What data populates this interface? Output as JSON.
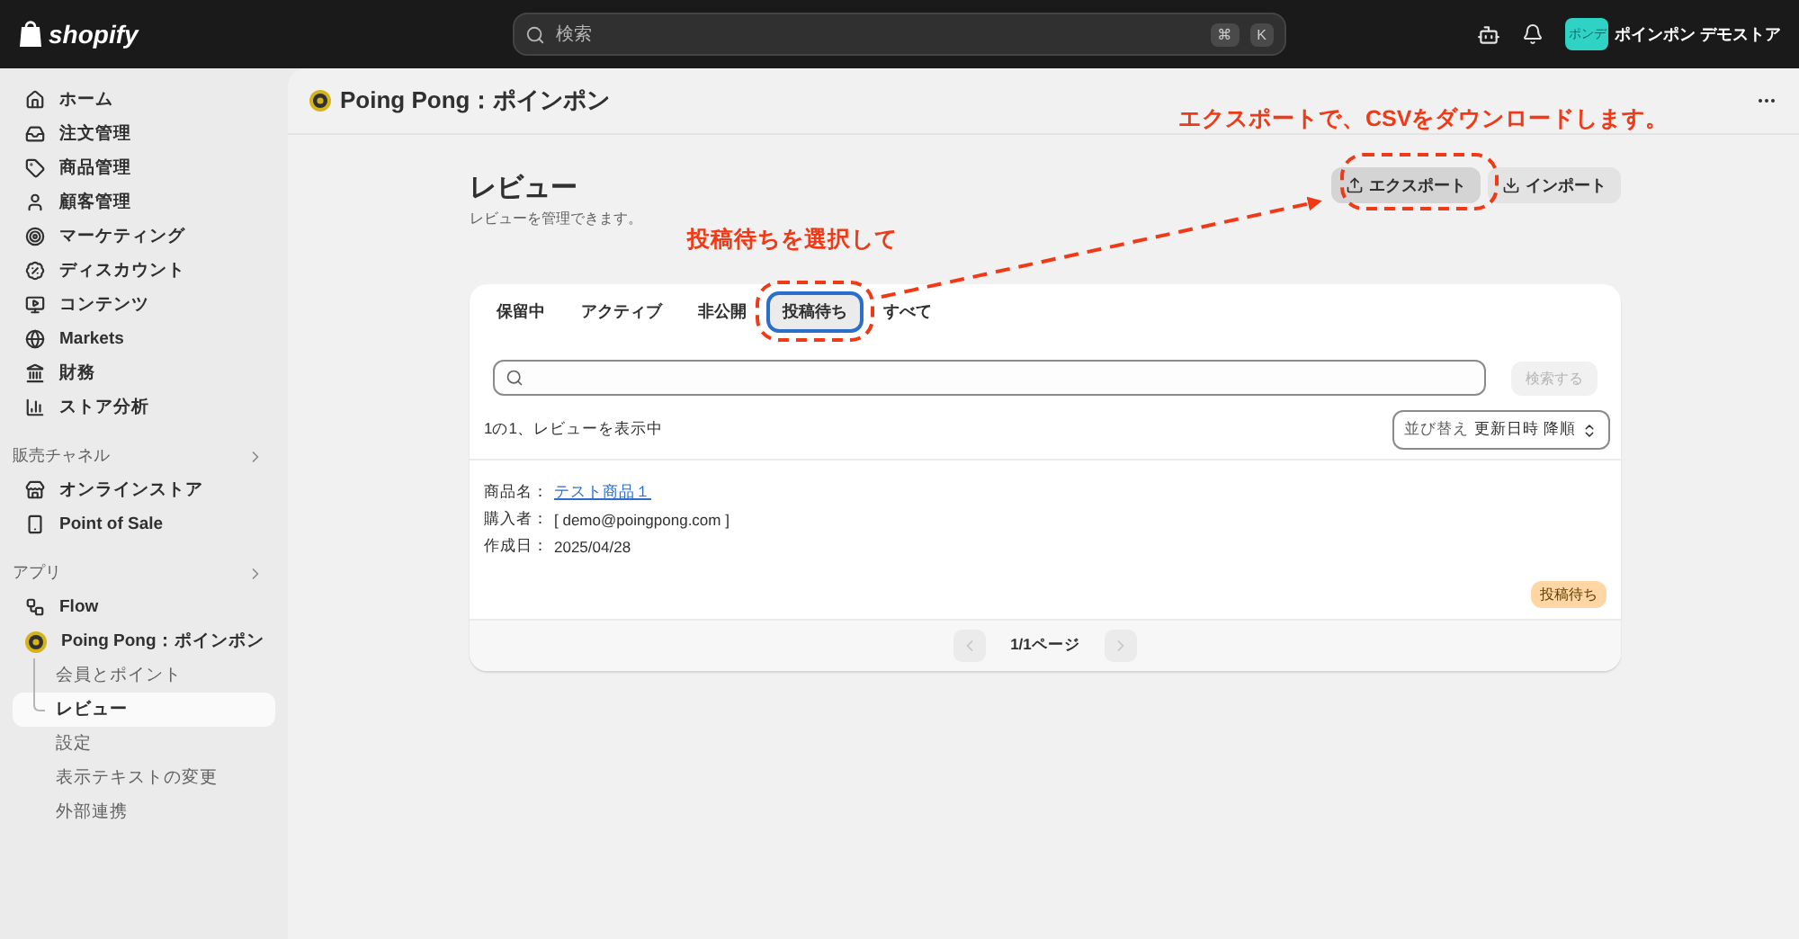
{
  "topbar": {
    "logo": "shopify",
    "search": {
      "placeholder": "検索",
      "keys": [
        "⌘",
        "K"
      ]
    },
    "store": {
      "avatar_text": "ポンデ",
      "name": "ポインポン デモストア"
    }
  },
  "sidebar": {
    "items": [
      {
        "label": "ホーム",
        "selected": false
      },
      {
        "label": "注文管理",
        "selected": false
      },
      {
        "label": "商品管理",
        "selected": false
      },
      {
        "label": "顧客管理",
        "selected": false
      },
      {
        "label": "マーケティング",
        "selected": false
      },
      {
        "label": "ディスカウント",
        "selected": false
      },
      {
        "label": "コンテンツ",
        "selected": false
      },
      {
        "label": "Markets",
        "selected": false
      },
      {
        "label": "財務",
        "selected": false
      },
      {
        "label": "ストア分析",
        "selected": false
      }
    ],
    "sections": [
      {
        "title": "販売チャネル",
        "items": [
          {
            "label": "オンラインストア",
            "selected": false
          },
          {
            "label": "Point of Sale",
            "selected": false
          }
        ]
      },
      {
        "title": "アプリ",
        "items": [
          {
            "label": "Flow",
            "selected": false
          },
          {
            "label": "Poing Pong：ポインポン",
            "selected": false,
            "children": [
              {
                "label": "会員とポイント",
                "selected": false
              },
              {
                "label": "レビュー",
                "selected": true
              },
              {
                "label": "設定",
                "selected": false
              },
              {
                "label": "表示テキストの変更",
                "selected": false
              },
              {
                "label": "外部連携",
                "selected": false
              }
            ]
          }
        ]
      }
    ]
  },
  "app_header": {
    "title": "Poing Pong：ポインポン"
  },
  "page": {
    "title": "レビュー",
    "subtitle": "レビューを管理できます。",
    "actions": [
      {
        "label": "エクスポート",
        "kind": "export",
        "pressed": true
      },
      {
        "label": "インポート",
        "kind": "import",
        "pressed": false
      }
    ]
  },
  "card": {
    "tabs": [
      {
        "label": "保留中",
        "selected": false
      },
      {
        "label": "アクティブ",
        "selected": false
      },
      {
        "label": "非公開",
        "selected": false
      },
      {
        "label": "投稿待ち",
        "selected": true
      },
      {
        "label": "すべて",
        "selected": false
      }
    ],
    "search_button": {
      "label": "検索する",
      "disabled": true
    },
    "summary": "1の1、レビューを表示中",
    "sort": {
      "label": "並び替え",
      "value": "更新日時 降順"
    },
    "reviews": [
      {
        "fields": [
          {
            "label": "商品名：",
            "value": "テスト商品１",
            "kind": "link"
          },
          {
            "label": "購入者：",
            "value": "[ demo@poingpong.com ]",
            "kind": "text"
          },
          {
            "label": "作成日：",
            "value": "2025/04/28",
            "kind": "text"
          }
        ],
        "status": "投稿待ち"
      }
    ],
    "pagination": {
      "label": "1/1ページ",
      "prev_disabled": true,
      "next_disabled": true
    }
  },
  "annotations": {
    "export_note": "エクスポートで、CSVをダウンロードします。",
    "tab_note": "投稿待ちを選択して"
  }
}
